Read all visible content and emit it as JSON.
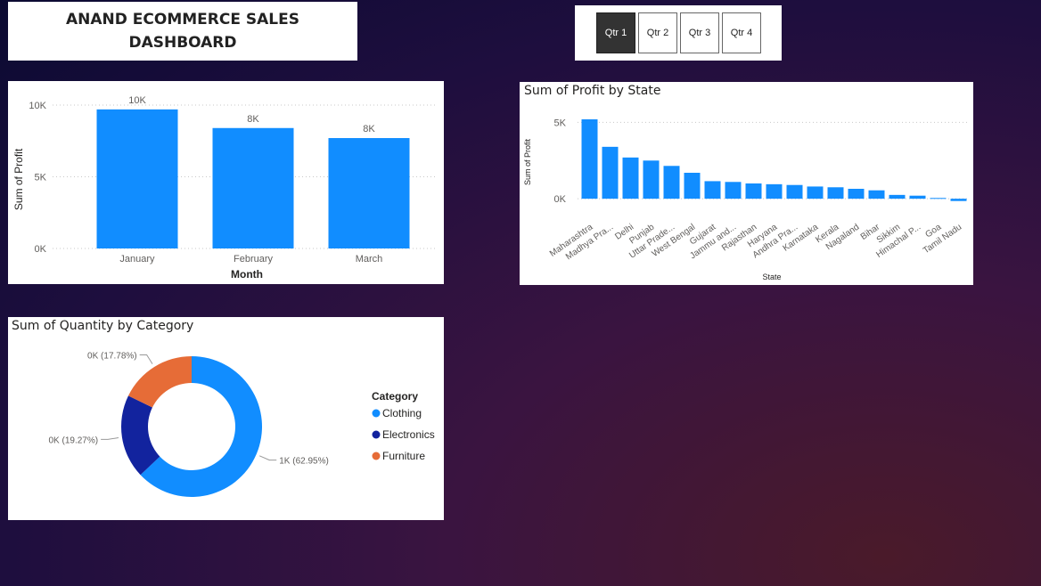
{
  "header": {
    "title": "ANAND ECOMMERCE SALES\nDASHBOARD"
  },
  "slicer": {
    "options": [
      "Qtr 1",
      "Qtr 2",
      "Qtr 3",
      "Qtr 4"
    ],
    "selected": "Qtr 1"
  },
  "colors": {
    "bar": "#118dff",
    "clothing": "#118dff",
    "electronics": "#12239e",
    "furniture": "#e66c37"
  },
  "chart_data": [
    {
      "type": "bar",
      "title": "",
      "xlabel": "Month",
      "ylabel": "Sum of Profit",
      "categories": [
        "January",
        "February",
        "March"
      ],
      "values": [
        9700,
        8400,
        7700
      ],
      "data_labels": [
        "10K",
        "8K",
        "8K"
      ],
      "yticks": [
        {
          "value": 0,
          "label": "0K"
        },
        {
          "value": 5000,
          "label": "5K"
        },
        {
          "value": 10000,
          "label": "10K"
        }
      ],
      "ylim": [
        0,
        10000
      ],
      "grid": true
    },
    {
      "type": "bar",
      "title": "Sum of Profit by State",
      "xlabel": "State",
      "ylabel": "Sum of Profit",
      "categories": [
        "Maharashtra",
        "Madhya Pra...",
        "Delhi",
        "Punjab",
        "Uttar Prade...",
        "West Bengal",
        "Gujarat",
        "Jammu and...",
        "Rajasthan",
        "Haryana",
        "Andhra Pra...",
        "Karnataka",
        "Kerala",
        "Nagaland",
        "Bihar",
        "Sikkim",
        "Himachal P...",
        "Goa",
        "Tamil Nadu"
      ],
      "values": [
        5200,
        3400,
        2700,
        2500,
        2150,
        1700,
        1150,
        1100,
        1000,
        950,
        900,
        800,
        750,
        650,
        550,
        250,
        200,
        50,
        -150
      ],
      "yticks": [
        {
          "value": 0,
          "label": "0K"
        },
        {
          "value": 5000,
          "label": "5K"
        }
      ],
      "ylim": [
        -400,
        5200
      ],
      "grid": true
    },
    {
      "type": "pie",
      "title": "Sum of Quantity by Category",
      "legend_title": "Category",
      "legend_position": "right",
      "slices": [
        {
          "name": "Clothing",
          "percent": 62.95,
          "label": "1K (62.95%)"
        },
        {
          "name": "Electronics",
          "percent": 19.27,
          "label": "0K (19.27%)"
        },
        {
          "name": "Furniture",
          "percent": 17.78,
          "label": "0K (17.78%)"
        }
      ]
    }
  ]
}
